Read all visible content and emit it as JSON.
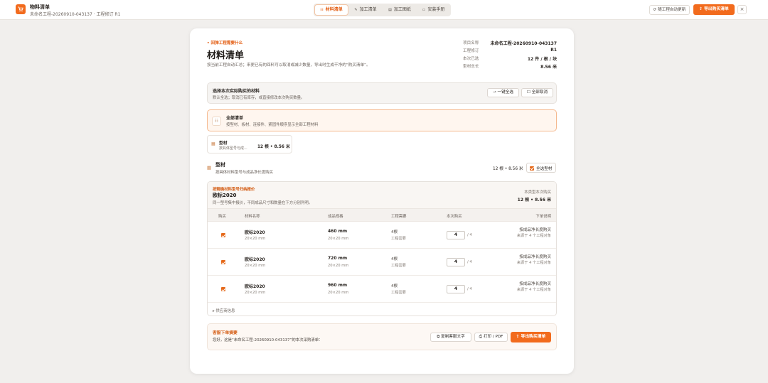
{
  "header": {
    "title": "物料清单",
    "subtitle": "未命名工程-20260910-043137 · 工程修订 R1",
    "tabs": [
      {
        "label": "材料清单",
        "icon": "list-icon",
        "active": true
      },
      {
        "label": "加工清单",
        "icon": "pencil-icon",
        "active": false
      },
      {
        "label": "加工图纸",
        "icon": "drawing-icon",
        "active": false
      },
      {
        "label": "安装手册",
        "icon": "book-icon",
        "active": false
      }
    ],
    "auto_update_label": "随工程自动更新",
    "export_label": "导出购买清单",
    "close_label": "×"
  },
  "page": {
    "back_label": "• 回弹工程需要什么",
    "title": "材料清单",
    "description": "按当前工程自动汇总；来更已有的回料可以取消或减少数量，导出时生成干净的“购买清单”。",
    "info": [
      {
        "label": "项目名称",
        "value": "未命名工程-20260910-043137"
      },
      {
        "label": "工程修订",
        "value": "R1"
      },
      {
        "label": "本次已选",
        "value": "12 件 / 根 / 块"
      },
      {
        "label": "型材总长",
        "value": "8.56 米"
      }
    ]
  },
  "selection": {
    "title": "选择本次实际购买的材料",
    "description": "默认全选；取消已有库存，或直接修改本次购买数量。",
    "select_all_label": "一键全选",
    "clear_all_label": "全部取消"
  },
  "all_list": {
    "title": "全部清单",
    "description": "按型材、板材、连接件、紧固件顺序显示全部工程材料"
  },
  "mini_card": {
    "title": "型材",
    "description": "按具体型号与成...",
    "value": "12 根 • 8.56 米"
  },
  "section": {
    "title": "型材",
    "description": "按具体材料型号与成品净长度购买",
    "value": "12 根 • 8.56 米",
    "select_all_label": "全选型材"
  },
  "group": {
    "tag": "按精确材料型号归纳报价",
    "title": "欧标2020",
    "description": "同一型号集中报价，不同成品尺寸和数量在下方分别列明。",
    "right_label": "本类型本次购买",
    "right_value": "12 根 • 8.56 米",
    "columns": [
      "购买",
      "材料名称",
      "成品规格",
      "工程需要",
      "本次购买",
      "下单说明"
    ],
    "rows": [
      {
        "name": "欧标2020",
        "spec": "20×20 mm",
        "length": "460 mm",
        "length_sub": "20×20 mm",
        "need": "4根",
        "need_sub": "工程需要",
        "qty": "4",
        "qty_total": "/ 4",
        "note": "按成品净长度购买",
        "note_sub": "来源于 4 个工程对象"
      },
      {
        "name": "欧标2020",
        "spec": "20×20 mm",
        "length": "720 mm",
        "length_sub": "20×20 mm",
        "need": "4根",
        "need_sub": "工程需要",
        "qty": "4",
        "qty_total": "/ 4",
        "note": "按成品净长度购买",
        "note_sub": "来源于 4 个工程对象"
      },
      {
        "name": "欧标2020",
        "spec": "20×20 mm",
        "length": "960 mm",
        "length_sub": "20×20 mm",
        "need": "4根",
        "need_sub": "工程需要",
        "qty": "4",
        "qty_total": "/ 4",
        "note": "按成品净长度购买",
        "note_sub": "来源于 4 个工程对象"
      }
    ],
    "footer_label": "▸ 供应商信息"
  },
  "customer_service": {
    "title": "客服下单摘要",
    "description": "您好，这是“未命名工程-20260910-043137”的本次采购清单：",
    "copy_label": "复制客服文字",
    "print_label": "打印 / PDF",
    "export_label": "导出购买清单"
  },
  "colors": {
    "accent": "#f26b1d",
    "background": "#f1efed"
  }
}
